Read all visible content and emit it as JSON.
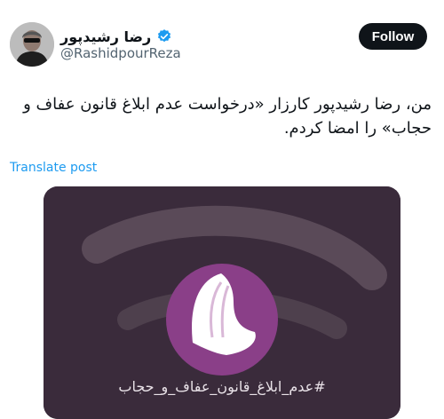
{
  "author": {
    "display_name": "رضا رشیدپور",
    "handle": "@RashidpourReza",
    "verified": true,
    "avatar_icon": "profile-photo"
  },
  "follow_button": {
    "label": "Follow"
  },
  "tweet": {
    "text": "من، رضا رشیدپور کارزار «درخواست عدم ابلاغ قانون عفاف و حجاب» را امضا کردم.",
    "translate_label": "Translate post"
  },
  "media": {
    "hashtag": "#عدم_ابلاغ_قانون_عفاف_و_حجاب",
    "logo_icon": "hijab-emblem-icon",
    "colors": {
      "background": "#3a2b3b",
      "circle": "#8a3f88"
    }
  },
  "colors": {
    "accent": "#1d9bf0",
    "text": "#0f1419",
    "secondary": "#536471"
  }
}
